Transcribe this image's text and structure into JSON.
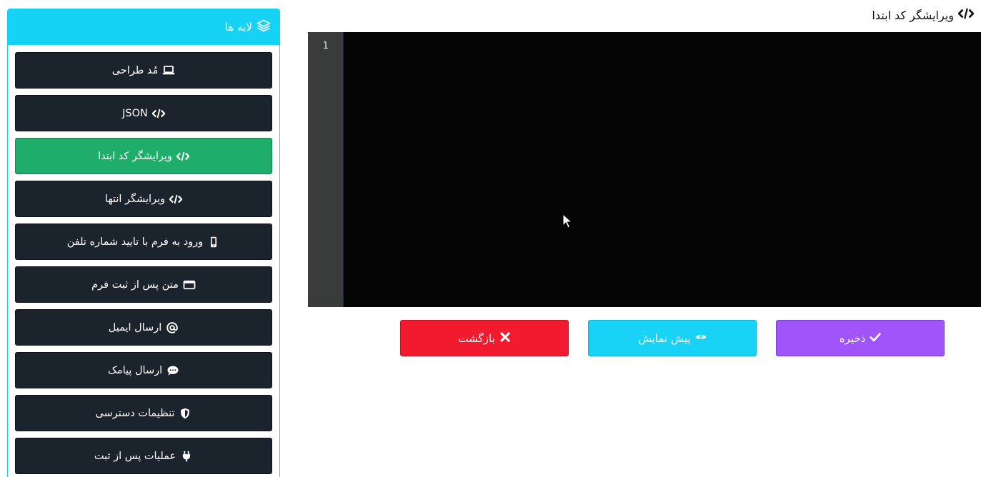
{
  "page": {
    "title": "ویرایشگر کد ابتدا",
    "title_icon": "code-icon"
  },
  "sidebar": {
    "header": {
      "label": "لایه ها",
      "icon": "layers-icon",
      "color": "#16d3f5"
    },
    "items": [
      {
        "label": "مُد طراحی",
        "icon": "laptop-icon",
        "active": false
      },
      {
        "label": "JSON",
        "icon": "code-icon",
        "active": false
      },
      {
        "label": "ویرایشگر کد ابتدا",
        "icon": "code-icon",
        "active": true
      },
      {
        "label": "ویرایشگر انتها",
        "icon": "code-icon",
        "active": false
      },
      {
        "label": "ورود به فرم با تایید شماره تلفن",
        "icon": "mobile-icon",
        "active": false
      },
      {
        "label": "متن پس از ثبت فرم",
        "icon": "window-icon",
        "active": false
      },
      {
        "label": "ارسال ایمیل",
        "icon": "at-icon",
        "active": false
      },
      {
        "label": "ارسال پیامک",
        "icon": "comment-icon",
        "active": false
      },
      {
        "label": "تنظیمات دسترسی",
        "icon": "shield-icon",
        "active": false
      },
      {
        "label": "عملیات پس از ثبت",
        "icon": "plug-icon",
        "active": false
      }
    ],
    "colors": {
      "default": "#1b232c",
      "active": "#1ead6a"
    }
  },
  "editor": {
    "line_numbers": [
      "1"
    ],
    "content": "",
    "background": "#050505",
    "gutter_background": "#3a3b3b"
  },
  "actions": {
    "save": {
      "label": "ذخیره",
      "icon": "check-icon",
      "color": "#9f55fa"
    },
    "preview": {
      "label": "پیش نمایش",
      "icon": "eye-icon",
      "color": "#18d3f6"
    },
    "back": {
      "label": "بازگشت",
      "icon": "close-icon",
      "color": "#f21a2f"
    }
  }
}
